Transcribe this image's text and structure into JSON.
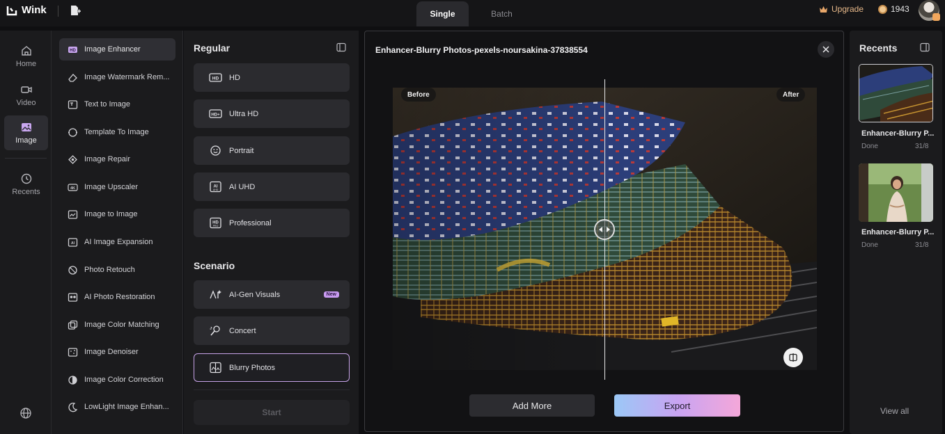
{
  "app": {
    "name": "Wink"
  },
  "header": {
    "tabs": [
      {
        "label": "Single",
        "active": true
      },
      {
        "label": "Batch",
        "active": false
      }
    ],
    "upgrade_label": "Upgrade",
    "coins": "1943"
  },
  "rail": {
    "items": [
      {
        "label": "Home",
        "icon": "home-icon"
      },
      {
        "label": "Video",
        "icon": "video-icon"
      },
      {
        "label": "Image",
        "icon": "image-icon",
        "active": true
      },
      {
        "label": "Recents",
        "icon": "history-icon"
      }
    ]
  },
  "tools": {
    "items": [
      {
        "label": "Image Enhancer",
        "icon": "hd-icon",
        "active": true
      },
      {
        "label": "Image Watermark Rem...",
        "icon": "eraser-icon"
      },
      {
        "label": "Text to Image",
        "icon": "text-image-icon"
      },
      {
        "label": "Template To Image",
        "icon": "template-icon"
      },
      {
        "label": "Image Repair",
        "icon": "repair-icon"
      },
      {
        "label": "Image Upscaler",
        "icon": "4k-icon"
      },
      {
        "label": "Image to Image",
        "icon": "image-to-image-icon"
      },
      {
        "label": "AI Image Expansion",
        "icon": "expand-icon"
      },
      {
        "label": "Photo Retouch",
        "icon": "retouch-icon"
      },
      {
        "label": "AI Photo Restoration",
        "icon": "restore-icon"
      },
      {
        "label": "Image Color Matching",
        "icon": "color-match-icon"
      },
      {
        "label": "Image Denoiser",
        "icon": "denoise-icon"
      },
      {
        "label": "Image Color Correction",
        "icon": "color-correct-icon"
      },
      {
        "label": "LowLight Image Enhan...",
        "icon": "lowlight-icon"
      }
    ]
  },
  "options": {
    "regular_heading": "Regular",
    "regular": [
      {
        "label": "HD",
        "icon": "hd-icon"
      },
      {
        "label": "Ultra HD",
        "icon": "hd-plus-icon"
      },
      {
        "label": "Portrait",
        "icon": "smile-icon"
      },
      {
        "label": "AI UHD",
        "icon": "ai-uhd-icon"
      },
      {
        "label": "Professional",
        "icon": "hd-pro-icon"
      }
    ],
    "scenario_heading": "Scenario",
    "scenario": [
      {
        "label": "AI-Gen Visuals",
        "icon": "ai-visual-icon",
        "badge": "New"
      },
      {
        "label": "Concert",
        "icon": "concert-icon"
      },
      {
        "label": "Blurry Photos",
        "icon": "blurry-icon",
        "active": true
      }
    ],
    "start_label": "Start"
  },
  "main": {
    "title": "Enhancer-Blurry Photos-pexels-noursakina-37838554",
    "before_label": "Before",
    "after_label": "After",
    "add_more_label": "Add More",
    "export_label": "Export"
  },
  "recents": {
    "title": "Recents",
    "items": [
      {
        "name": "Enhancer-Blurry P...",
        "status": "Done",
        "date": "31/8"
      },
      {
        "name": "Enhancer-Blurry P...",
        "status": "Done",
        "date": "31/8"
      }
    ],
    "view_all_label": "View all"
  }
}
